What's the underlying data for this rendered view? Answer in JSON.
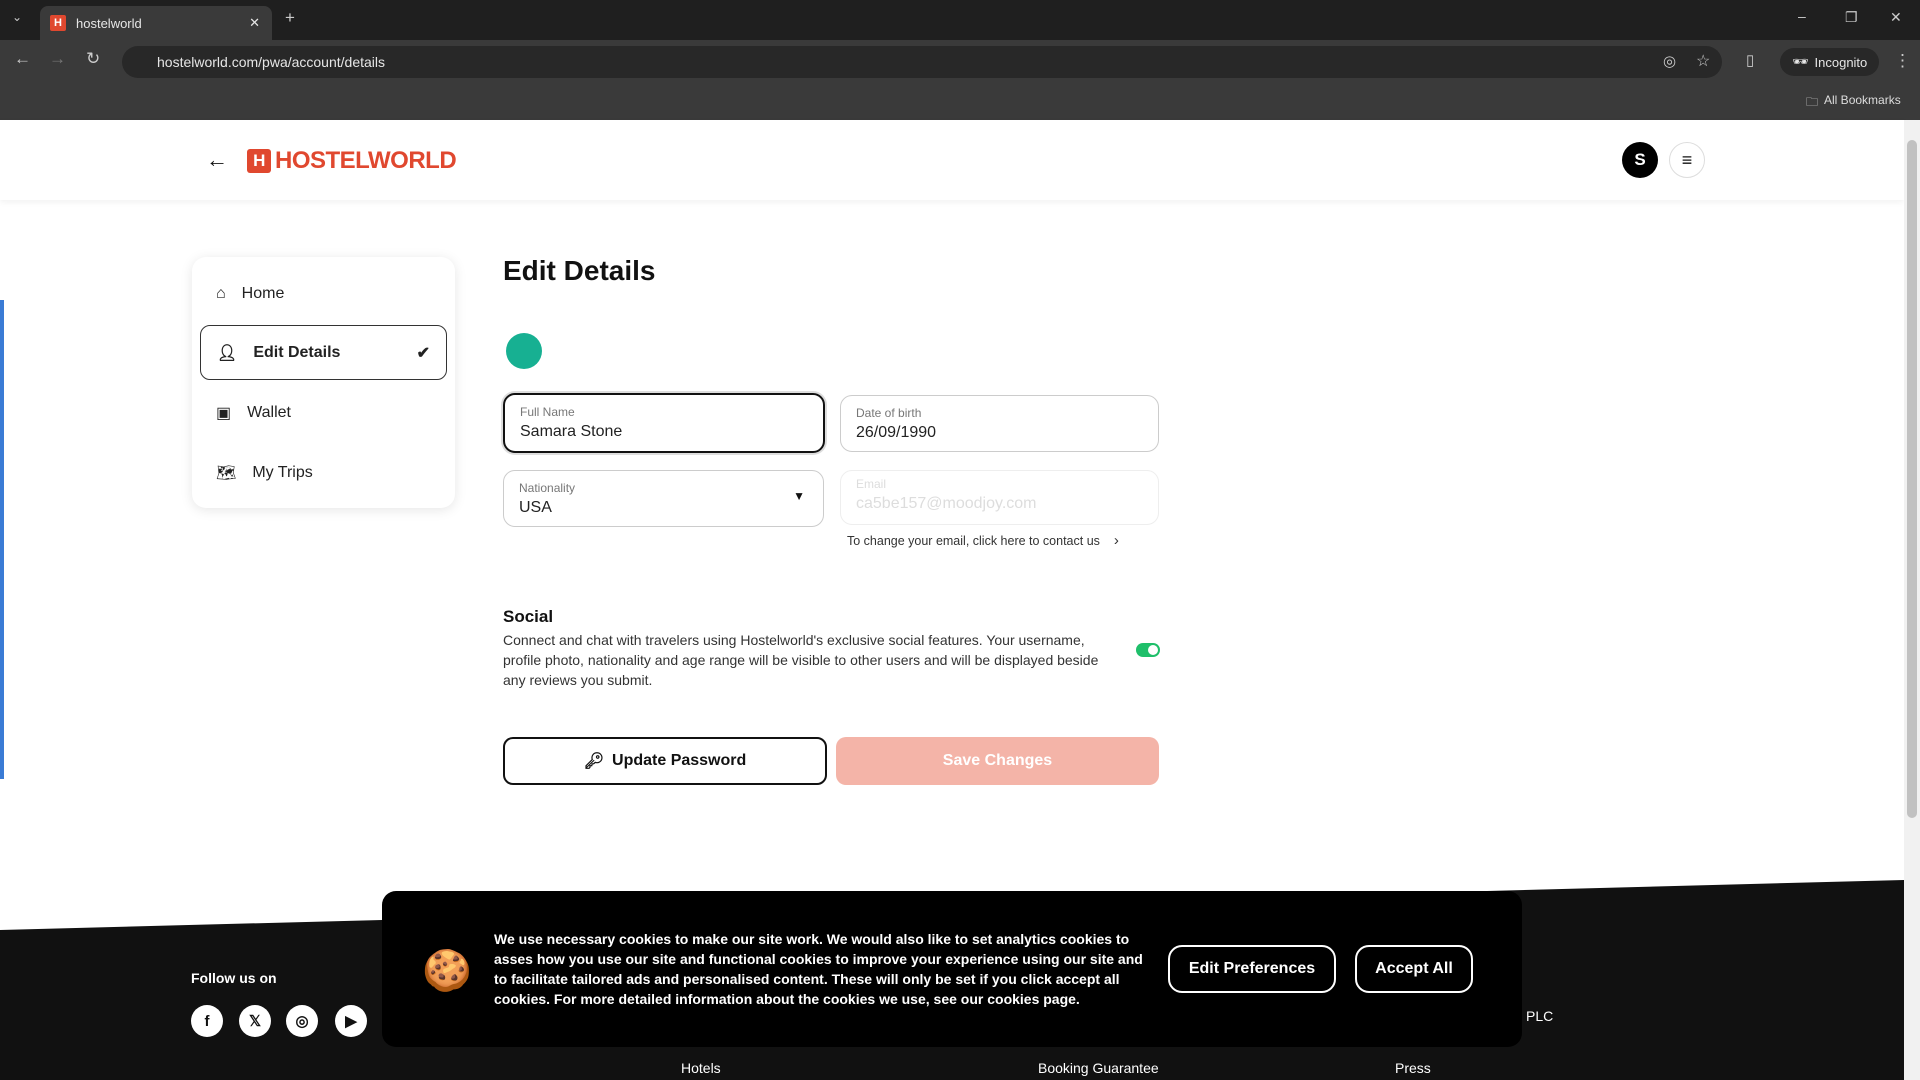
{
  "browser": {
    "tab_title": "hostelworld",
    "url": "hostelworld.com/pwa/account/details",
    "incognito": "Incognito",
    "bookmarks": "All Bookmarks"
  },
  "header": {
    "logo": "HOSTELWORLD",
    "avatar_initial": "S"
  },
  "sidebar": {
    "items": [
      {
        "label": "Home",
        "icon": "home-icon"
      },
      {
        "label": "Edit Details",
        "icon": "user-icon",
        "active": true
      },
      {
        "label": "Wallet",
        "icon": "wallet-icon"
      },
      {
        "label": "My Trips",
        "icon": "map-icon"
      }
    ]
  },
  "main": {
    "title": "Edit Details",
    "fields": {
      "full_name": {
        "label": "Full Name",
        "value": "Samara Stone"
      },
      "dob": {
        "label": "Date of birth",
        "value": "26/09/1990"
      },
      "nationality": {
        "label": "Nationality",
        "value": "USA"
      },
      "email": {
        "label": "Email",
        "value": "ca5be157@moodjoy.com"
      }
    },
    "contact_note": "To change your email, click here to contact us",
    "social": {
      "title": "Social",
      "description": "Connect and chat with travelers using Hostelworld's exclusive social features. Your username, profile photo, nationality and age range will be visible to other users and will be displayed beside any reviews you submit.",
      "enabled": true
    },
    "update_password": "Update Password",
    "save_changes": "Save Changes"
  },
  "footer": {
    "follow": "Follow us on",
    "links": [
      "Hotels",
      "Booking Guarantee",
      "Press"
    ],
    "plc": "PLC"
  },
  "cookie": {
    "text": "We use necessary cookies to make our site work. We would also like to set analytics cookies to asses how you use our site and functional cookies to improve your experience using our site and to facilitate tailored ads and personalised content. These will only be set if you click accept all cookies. For more detailed information about the cookies we use, see our cookies page.",
    "edit": "Edit Preferences",
    "accept": "Accept All"
  },
  "colors": {
    "brand": "#e0482f",
    "toggle": "#1fbf6a",
    "avatar_circle": "#17b092"
  }
}
